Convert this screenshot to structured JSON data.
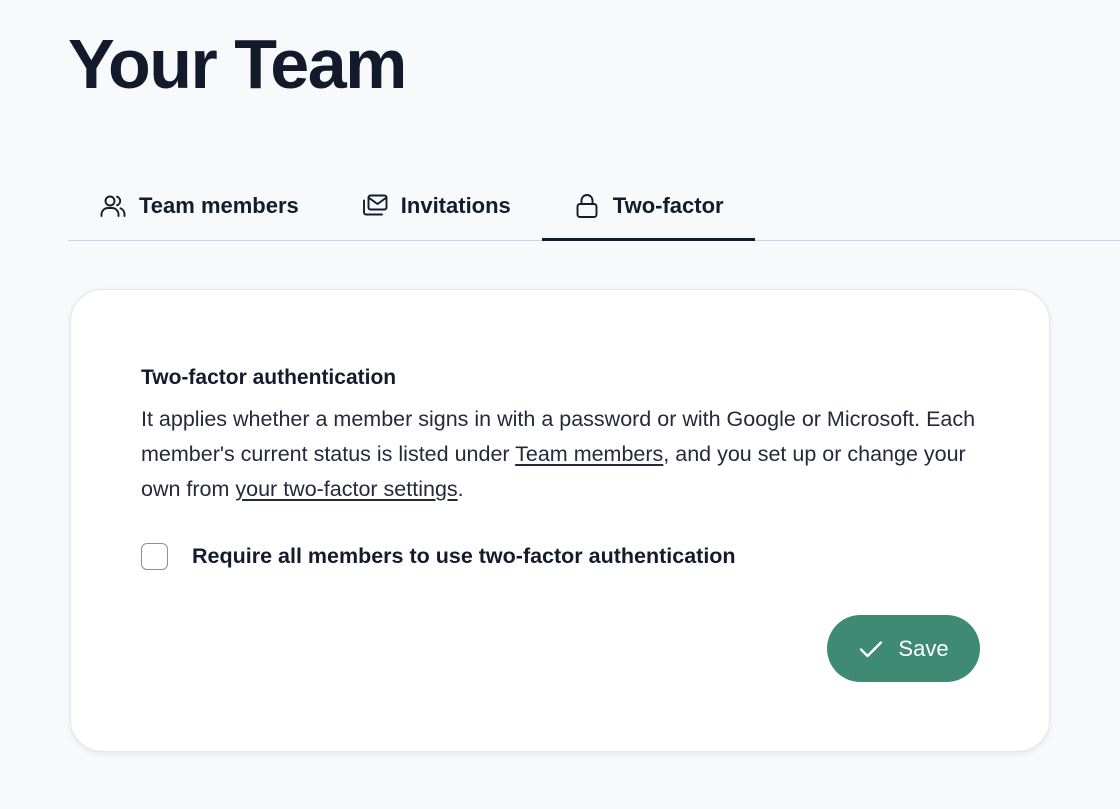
{
  "page": {
    "title": "Your Team"
  },
  "tabs": [
    {
      "label": "Team members",
      "icon": "users-icon",
      "active": false
    },
    {
      "label": "Invitations",
      "icon": "mail-stack-icon",
      "active": false
    },
    {
      "label": "Two-factor",
      "icon": "lock-icon",
      "active": true
    }
  ],
  "card": {
    "heading": "Two-factor authentication",
    "description": {
      "line1": "It applies whether a member signs in with a password or with Google or Microsoft. Each member's current status is listed under ",
      "link1": "Team members",
      "line2": ", and you set up or change your own from ",
      "link2": "your two-factor settings",
      "line3": "."
    },
    "checkbox": {
      "label": "Require all members to use two-factor authentication",
      "checked": false
    },
    "save_button": {
      "label": "Save",
      "icon": "check-icon"
    }
  },
  "colors": {
    "background": "#f8f9fb",
    "text": "#141b2d",
    "accent": "#3f8a73",
    "card": "#ffffff"
  }
}
